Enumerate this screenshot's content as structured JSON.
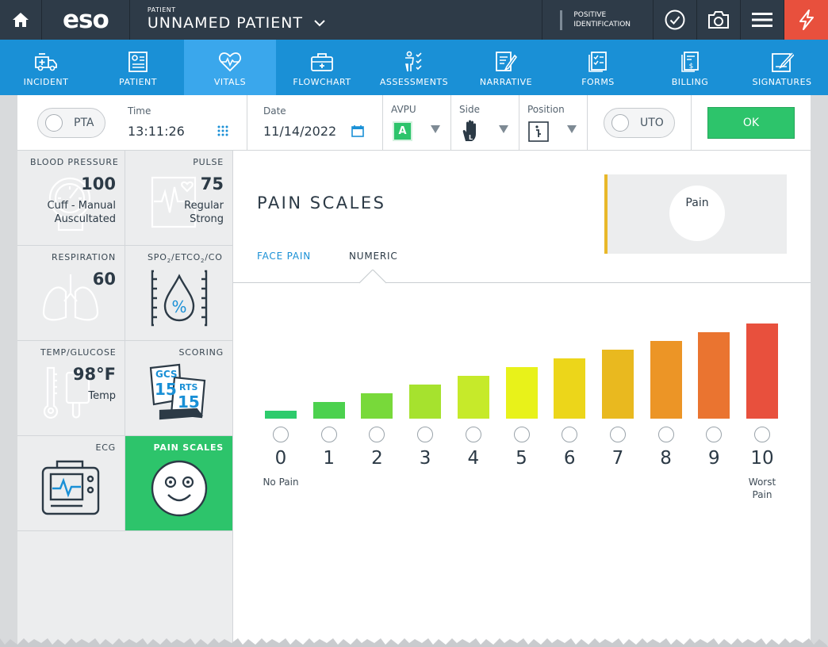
{
  "topbar": {
    "logo": "eso",
    "patient_label": "PATIENT",
    "patient_name": "UNNAMED PATIENT",
    "positive_id_line1": "POSITIVE",
    "positive_id_line2": "IDENTIFICATION",
    "icons": [
      "home-icon",
      "check-circle-icon",
      "camera-icon",
      "menu-icon",
      "flash-icon"
    ]
  },
  "nav": [
    {
      "label": "INCIDENT",
      "icon": "ambulance-icon"
    },
    {
      "label": "PATIENT",
      "icon": "id-card-icon"
    },
    {
      "label": "VITALS",
      "icon": "heart-pulse-icon",
      "active": true
    },
    {
      "label": "FLOWCHART",
      "icon": "medkit-icon"
    },
    {
      "label": "ASSESSMENTS",
      "icon": "body-check-icon"
    },
    {
      "label": "NARRATIVE",
      "icon": "notepad-pen-icon"
    },
    {
      "label": "FORMS",
      "icon": "checklist-icon"
    },
    {
      "label": "BILLING",
      "icon": "invoice-icon"
    },
    {
      "label": "SIGNATURES",
      "icon": "signature-icon"
    }
  ],
  "subbar": {
    "pta_label": "PTA",
    "time_label": "Time",
    "time_value": "13:11:26",
    "date_label": "Date",
    "date_value": "11/14/2022",
    "avpu_label": "AVPU",
    "avpu_value": "A",
    "side_label": "Side",
    "position_label": "Position",
    "uto_label": "UTO",
    "ok_label": "OK"
  },
  "tiles": {
    "blood_pressure": {
      "title": "BLOOD PRESSURE",
      "value": "100",
      "line1": "Cuff - Manual",
      "line2": "Auscultated"
    },
    "pulse": {
      "title": "PULSE",
      "value": "75",
      "line1": "Regular",
      "line2": "Strong"
    },
    "respiration": {
      "title": "RESPIRATION",
      "value": "60"
    },
    "spo2": {
      "title_parts": [
        "SPO",
        "2",
        "/ETCO",
        "2",
        "/CO"
      ]
    },
    "temp": {
      "title": "TEMP/GLUCOSE",
      "value": "98°F",
      "line1": "Temp"
    },
    "scoring": {
      "title": "SCORING",
      "gcs": "GCS",
      "gcs_val": "15",
      "rts": "RTS",
      "rts_val": "15"
    },
    "ecg": {
      "title": "ECG"
    },
    "pain": {
      "title": "PAIN SCALES"
    }
  },
  "content": {
    "title": "PAIN SCALES",
    "tabs": {
      "face": "FACE PAIN",
      "numeric": "NUMERIC"
    },
    "pain_box_label": "Pain"
  },
  "scale": {
    "levels": [
      {
        "num": "0",
        "desc": "No Pain",
        "color": "#2dcb6c"
      },
      {
        "num": "1",
        "desc": "",
        "color": "#4cd14e"
      },
      {
        "num": "2",
        "desc": "",
        "color": "#78d93a"
      },
      {
        "num": "3",
        "desc": "",
        "color": "#a6e22e"
      },
      {
        "num": "4",
        "desc": "",
        "color": "#c6ea2a"
      },
      {
        "num": "5",
        "desc": "",
        "color": "#e8f21a"
      },
      {
        "num": "6",
        "desc": "",
        "color": "#ecd61a"
      },
      {
        "num": "7",
        "desc": "",
        "color": "#e9b91f"
      },
      {
        "num": "8",
        "desc": "",
        "color": "#ec9526"
      },
      {
        "num": "9",
        "desc": "",
        "color": "#ea7430"
      },
      {
        "num": "10",
        "desc": "Worst\nPain",
        "color": "#e8503d"
      }
    ]
  }
}
